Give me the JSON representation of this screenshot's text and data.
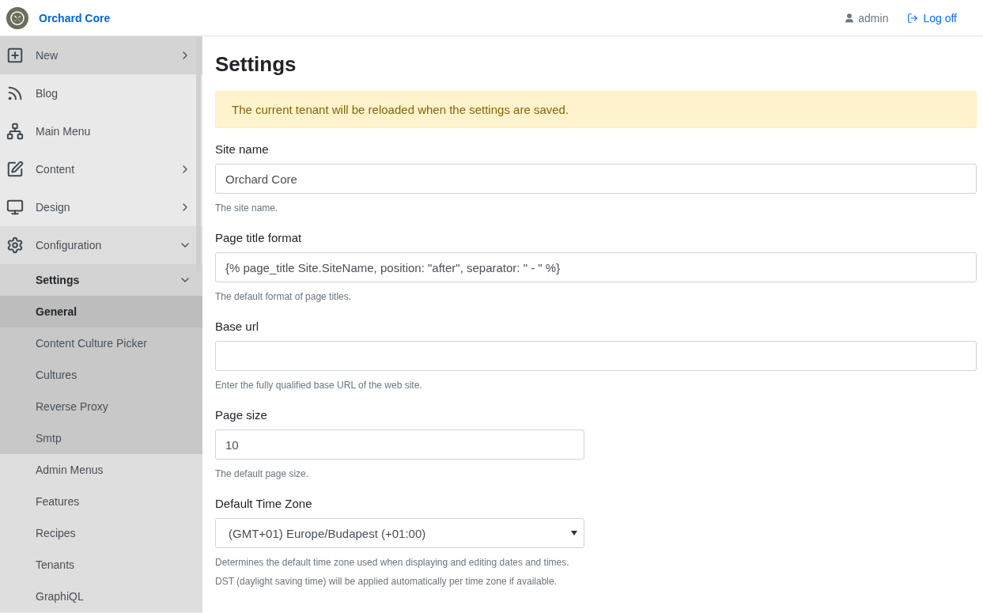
{
  "header": {
    "brand": "Orchard Core",
    "user": "admin",
    "logoff": "Log off"
  },
  "sidebar": {
    "items": [
      {
        "label": "New",
        "highlighted": true,
        "expandable": true,
        "expanded": false
      },
      {
        "label": "Blog",
        "highlighted": false,
        "expandable": false,
        "expanded": false
      },
      {
        "label": "Main Menu",
        "highlighted": false,
        "expandable": false,
        "expanded": false
      },
      {
        "label": "Content",
        "highlighted": false,
        "expandable": true,
        "expanded": false
      },
      {
        "label": "Design",
        "highlighted": false,
        "expandable": true,
        "expanded": false
      },
      {
        "label": "Configuration",
        "highlighted": false,
        "expandable": true,
        "expanded": true,
        "children": [
          {
            "label": "Settings",
            "selected": false,
            "expandable": true,
            "expanded": true,
            "children": [
              {
                "label": "General",
                "selected": true
              },
              {
                "label": "Content Culture Picker",
                "selected": false
              },
              {
                "label": "Cultures",
                "selected": false
              },
              {
                "label": "Reverse Proxy",
                "selected": false
              },
              {
                "label": "Smtp",
                "selected": false
              }
            ]
          },
          {
            "label": "Admin Menus",
            "selected": false,
            "expandable": false,
            "expanded": false
          },
          {
            "label": "Features",
            "selected": false,
            "expandable": false,
            "expanded": false
          },
          {
            "label": "Recipes",
            "selected": false,
            "expandable": false,
            "expanded": false
          },
          {
            "label": "Tenants",
            "selected": false,
            "expandable": false,
            "expanded": false
          },
          {
            "label": "GraphiQL",
            "selected": false,
            "expandable": false,
            "expanded": false
          }
        ]
      }
    ]
  },
  "page": {
    "title": "Settings",
    "alert": "The current tenant will be reloaded when the settings are saved.",
    "fields": [
      {
        "kind": "text",
        "label": "Site name",
        "value": "Orchard Core",
        "hint": "The site name.",
        "wide": true
      },
      {
        "kind": "text",
        "label": "Page title format",
        "value": "{% page_title Site.SiteName, position: \"after\", separator: \" - \" %}",
        "hint": "The default format of page titles.",
        "wide": true
      },
      {
        "kind": "text",
        "label": "Base url",
        "hint": "Enter the fully qualified base URL of the web site.",
        "wide": true
      },
      {
        "kind": "text",
        "label": "Page size",
        "value": "10",
        "hint": "The default page size.",
        "wide": false
      },
      {
        "kind": "select",
        "label": "Default Time Zone",
        "value": "(GMT+01) Europe/Budapest (+01:00)",
        "hint": "Determines the default time zone used when displaying and editing dates and times. DST (daylight saving time) will be applied automatically per time zone if available.",
        "wide": false
      }
    ]
  }
}
